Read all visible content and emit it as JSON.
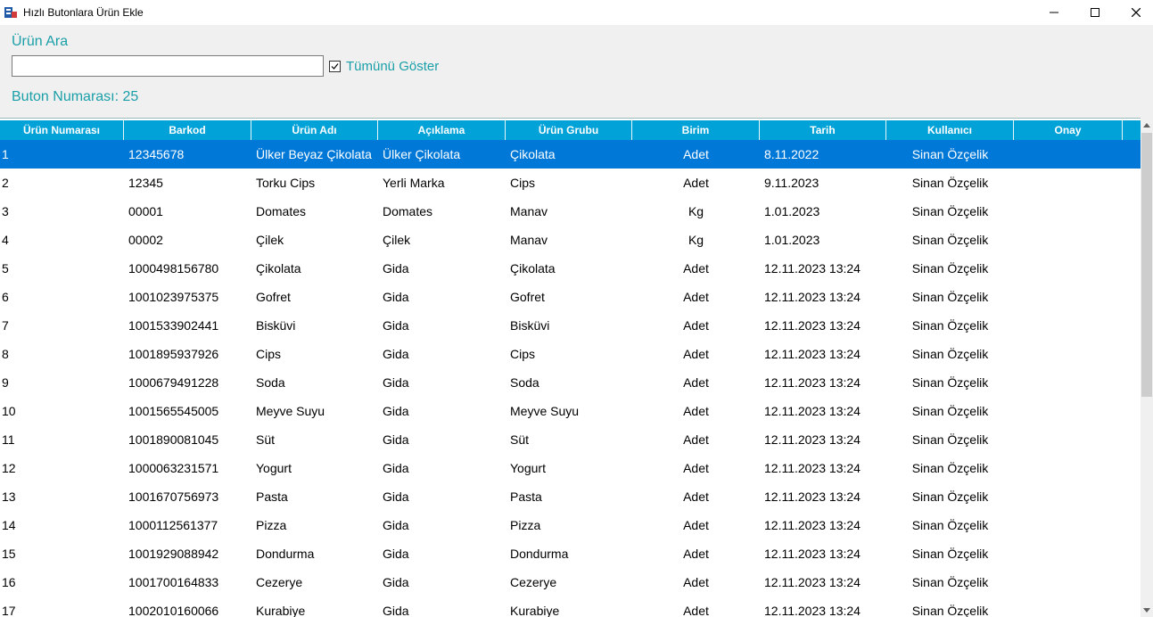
{
  "window": {
    "title": "Hızlı Butonlara Ürün Ekle"
  },
  "panel": {
    "search_label": "Ürün Ara",
    "search_value": "",
    "show_all_label": "Tümünü Göster",
    "show_all_checked": true,
    "button_number_label": "Buton Numarası:",
    "button_number_value": "25"
  },
  "colors": {
    "accent_text": "#1a9fa8",
    "header_bg": "#00a2d8",
    "selected_row": "#0078d7"
  },
  "grid": {
    "columns": [
      "Ürün Numarası",
      "Barkod",
      "Ürün Adı",
      "Açıklama",
      "Ürün Grubu",
      "Birim",
      "Tarih",
      "Kullanıcı",
      "Onay"
    ],
    "selected_index": 0,
    "rows": [
      [
        "1",
        "12345678",
        "Ülker Beyaz Çikolata",
        "Ülker Çikolata",
        "Çikolata",
        "Adet",
        "8.11.2022",
        "Sinan Özçelik",
        ""
      ],
      [
        "2",
        "12345",
        "Torku Cips",
        "Yerli Marka",
        "Cips",
        "Adet",
        "9.11.2023",
        "Sinan Özçelik",
        ""
      ],
      [
        "3",
        "00001",
        "Domates",
        "Domates",
        "Manav",
        "Kg",
        "1.01.2023",
        "Sinan Özçelik",
        ""
      ],
      [
        "4",
        "00002",
        "Çilek",
        "Çilek",
        "Manav",
        "Kg",
        "1.01.2023",
        "Sinan Özçelik",
        ""
      ],
      [
        "5",
        "1000498156780",
        "Çikolata",
        "Gida",
        "Çikolata",
        "Adet",
        "12.11.2023 13:24",
        "Sinan Özçelik",
        ""
      ],
      [
        "6",
        "1001023975375",
        "Gofret",
        "Gida",
        "Gofret",
        "Adet",
        "12.11.2023 13:24",
        "Sinan Özçelik",
        ""
      ],
      [
        "7",
        "1001533902441",
        "Bisküvi",
        "Gida",
        "Bisküvi",
        "Adet",
        "12.11.2023 13:24",
        "Sinan Özçelik",
        ""
      ],
      [
        "8",
        "1001895937926",
        "Cips",
        "Gida",
        "Cips",
        "Adet",
        "12.11.2023 13:24",
        "Sinan Özçelik",
        ""
      ],
      [
        "9",
        "1000679491228",
        "Soda",
        "Gida",
        "Soda",
        "Adet",
        "12.11.2023 13:24",
        "Sinan Özçelik",
        ""
      ],
      [
        "10",
        "1001565545005",
        "Meyve Suyu",
        "Gida",
        "Meyve Suyu",
        "Adet",
        "12.11.2023 13:24",
        "Sinan Özçelik",
        ""
      ],
      [
        "11",
        "1001890081045",
        "Süt",
        "Gida",
        "Süt",
        "Adet",
        "12.11.2023 13:24",
        "Sinan Özçelik",
        ""
      ],
      [
        "12",
        "1000063231571",
        "Yogurt",
        "Gida",
        "Yogurt",
        "Adet",
        "12.11.2023 13:24",
        "Sinan Özçelik",
        ""
      ],
      [
        "13",
        "1001670756973",
        "Pasta",
        "Gida",
        "Pasta",
        "Adet",
        "12.11.2023 13:24",
        "Sinan Özçelik",
        ""
      ],
      [
        "14",
        "1000112561377",
        "Pizza",
        "Gida",
        "Pizza",
        "Adet",
        "12.11.2023 13:24",
        "Sinan Özçelik",
        ""
      ],
      [
        "15",
        "1001929088942",
        "Dondurma",
        "Gida",
        "Dondurma",
        "Adet",
        "12.11.2023 13:24",
        "Sinan Özçelik",
        ""
      ],
      [
        "16",
        "1001700164833",
        "Cezerye",
        "Gida",
        "Cezerye",
        "Adet",
        "12.11.2023 13:24",
        "Sinan Özçelik",
        ""
      ],
      [
        "17",
        "1002010160066",
        "Kurabiye",
        "Gida",
        "Kurabiye",
        "Adet",
        "12.11.2023 13:24",
        "Sinan Özçelik",
        ""
      ]
    ]
  }
}
